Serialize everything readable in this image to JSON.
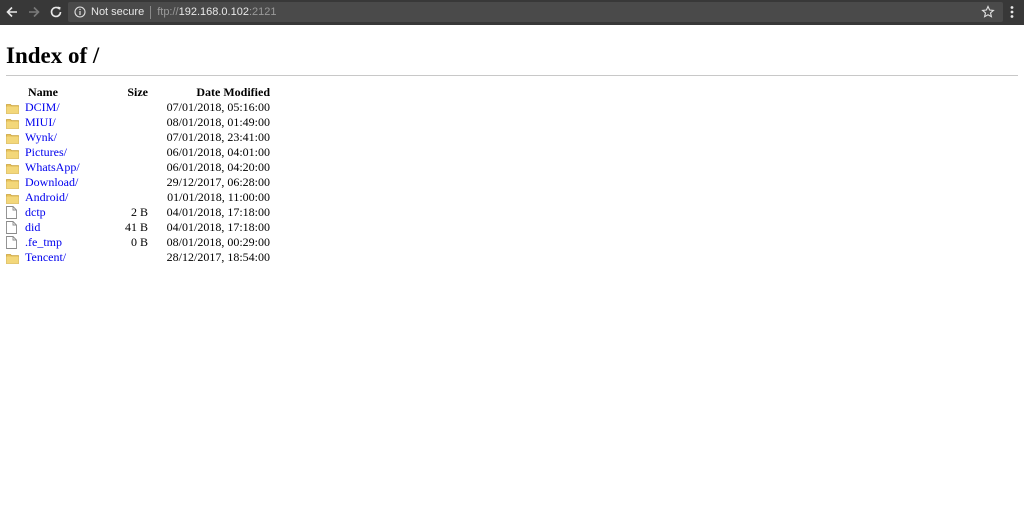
{
  "browser": {
    "security_label": "Not secure",
    "url_scheme": "ftp://",
    "url_host": "192.168.0.102",
    "url_port": ":2121"
  },
  "page": {
    "title": "Index of /",
    "columns": {
      "name": "Name",
      "size": "Size",
      "date": "Date Modified"
    }
  },
  "files": [
    {
      "icon": "folder-icon",
      "name": "DCIM/",
      "size": "",
      "date": "07/01/2018, 05:16:00"
    },
    {
      "icon": "folder-icon",
      "name": "MIUI/",
      "size": "",
      "date": "08/01/2018, 01:49:00"
    },
    {
      "icon": "folder-icon",
      "name": "Wynk/",
      "size": "",
      "date": "07/01/2018, 23:41:00"
    },
    {
      "icon": "folder-icon",
      "name": "Pictures/",
      "size": "",
      "date": "06/01/2018, 04:01:00"
    },
    {
      "icon": "folder-icon",
      "name": "WhatsApp/",
      "size": "",
      "date": "06/01/2018, 04:20:00"
    },
    {
      "icon": "folder-icon",
      "name": "Download/",
      "size": "",
      "date": "29/12/2017, 06:28:00"
    },
    {
      "icon": "folder-icon",
      "name": "Android/",
      "size": "",
      "date": "01/01/2018, 11:00:00"
    },
    {
      "icon": "file-icon",
      "name": "dctp",
      "size": "2 B",
      "date": "04/01/2018, 17:18:00"
    },
    {
      "icon": "file-icon",
      "name": "did",
      "size": "41 B",
      "date": "04/01/2018, 17:18:00"
    },
    {
      "icon": "file-icon",
      "name": ".fe_tmp",
      "size": "0 B",
      "date": "08/01/2018, 00:29:00"
    },
    {
      "icon": "folder-icon",
      "name": "Tencent/",
      "size": "",
      "date": "28/12/2017, 18:54:00"
    }
  ],
  "colors": {
    "toolbar": "#383838",
    "omnibox": "#4a4a4a",
    "link": "#0000ee",
    "folder": "#e8c25a"
  }
}
